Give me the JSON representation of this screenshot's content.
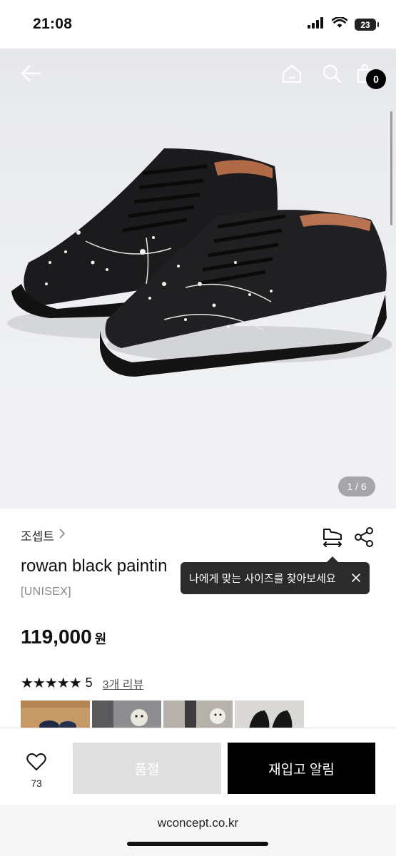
{
  "status_bar": {
    "time": "21:08",
    "battery": "23"
  },
  "header": {
    "cart_count": "0",
    "icons": [
      "back-arrow-icon",
      "home-icon",
      "search-icon",
      "cart-icon"
    ]
  },
  "gallery": {
    "counter": "1 / 6"
  },
  "product": {
    "brand": "조셉트",
    "name": "rowan black paintin",
    "tag": "[UNISEX]",
    "price": "119,000",
    "currency": "원",
    "stars": "★★★★★",
    "rating": "5",
    "review_link": "3개 리뷰"
  },
  "tooltip": {
    "text": "나에게 맞는 사이즈를 찾아보세요"
  },
  "action_bar": {
    "like_count": "73",
    "soldout_label": "품절",
    "restock_label": "재입고 알림"
  },
  "browser": {
    "url": "wconcept.co.kr"
  }
}
